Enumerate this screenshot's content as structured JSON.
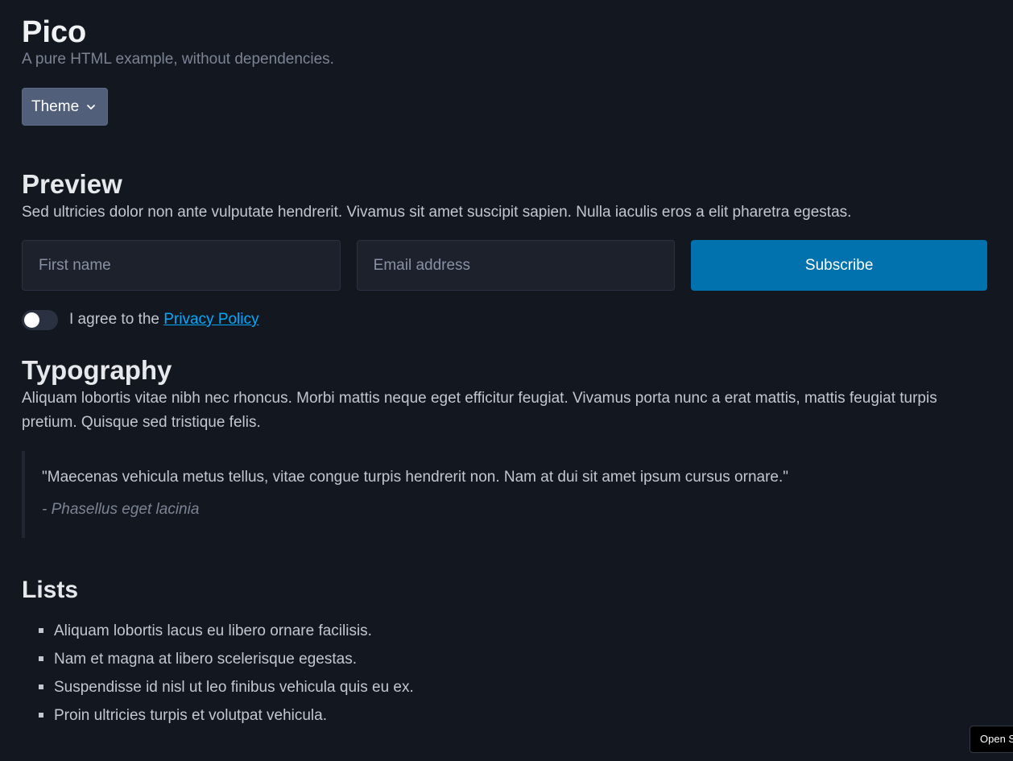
{
  "header": {
    "title": "Pico",
    "subtitle": "A pure HTML example, without dependencies.",
    "theme_button_label": "Theme",
    "theme_button_icon": "chevron-down-icon"
  },
  "preview": {
    "heading": "Preview",
    "paragraph": "Sed ultricies dolor non ante vulputate hendrerit. Vivamus sit amet suscipit sapien. Nulla iaculis eros a elit pharetra egestas.",
    "first_name_placeholder": "First name",
    "email_placeholder": "Email address",
    "subscribe_label": "Subscribe",
    "agree_text": "I agree to the",
    "privacy_link": "Privacy Policy",
    "switch_on": false
  },
  "typography": {
    "heading": "Typography",
    "paragraph": "Aliquam lobortis vitae nibh nec rhoncus. Morbi mattis neque eget efficitur feugiat. Vivamus porta nunc a erat mattis, mattis feugiat turpis pretium. Quisque sed tristique felis.",
    "quote": "\"Maecenas vehicula metus tellus, vitae congue turpis hendrerit non. Nam at dui sit amet ipsum cursus ornare.\"",
    "cite": "- Phasellus eget lacinia"
  },
  "lists": {
    "heading": "Lists",
    "items": [
      "Aliquam lobortis lacus eu libero ornare facilisis.",
      "Nam et magna at libero scelerisque egestas.",
      "Suspendisse id nisl ut leo finibus vehicula quis eu ex.",
      "Proin ultricies turpis et volutpat vehicula."
    ]
  },
  "overlay": {
    "open_tab_label": "Open S"
  },
  "colors": {
    "background": "#13171f",
    "primary": "#0172ad",
    "link": "#01aaff",
    "theme_button": "#525f7a"
  }
}
